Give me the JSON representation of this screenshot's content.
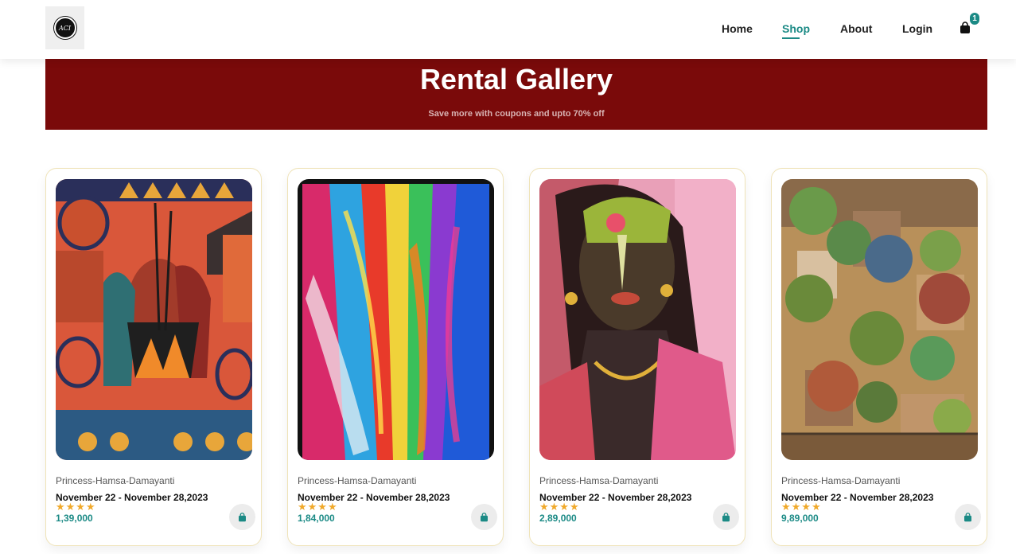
{
  "header": {
    "logo_text": "ACI",
    "nav": [
      "Home",
      "Shop",
      "About",
      "Login"
    ],
    "active_nav": "Shop",
    "cart_count": "1"
  },
  "banner": {
    "title": "Rental Gallery",
    "subtitle": "Save more with coupons and upto 70% off"
  },
  "products": [
    {
      "artist": "Princess-Hamsa-Damayanti",
      "dates": "November 22 - November 28,2023",
      "stars": "★★★★",
      "price": "1,39,000"
    },
    {
      "artist": "Princess-Hamsa-Damayanti",
      "dates": "November 22 - November 28,2023",
      "stars": "★★★★",
      "price": "1,84,000"
    },
    {
      "artist": "Princess-Hamsa-Damayanti",
      "dates": "November 22 - November 28,2023",
      "stars": "★★★★",
      "price": "2,89,000"
    },
    {
      "artist": "Princess-Hamsa-Damayanti",
      "dates": "November 22 - November 28,2023",
      "stars": "★★★★",
      "price": "9,89,000"
    }
  ],
  "colors": {
    "accent": "#1b8a85",
    "banner": "#7a0a0a",
    "star": "#f0a92a"
  },
  "icons": {
    "cart": "shopping-bag-icon",
    "card_button": "shopping-bag-icon"
  }
}
